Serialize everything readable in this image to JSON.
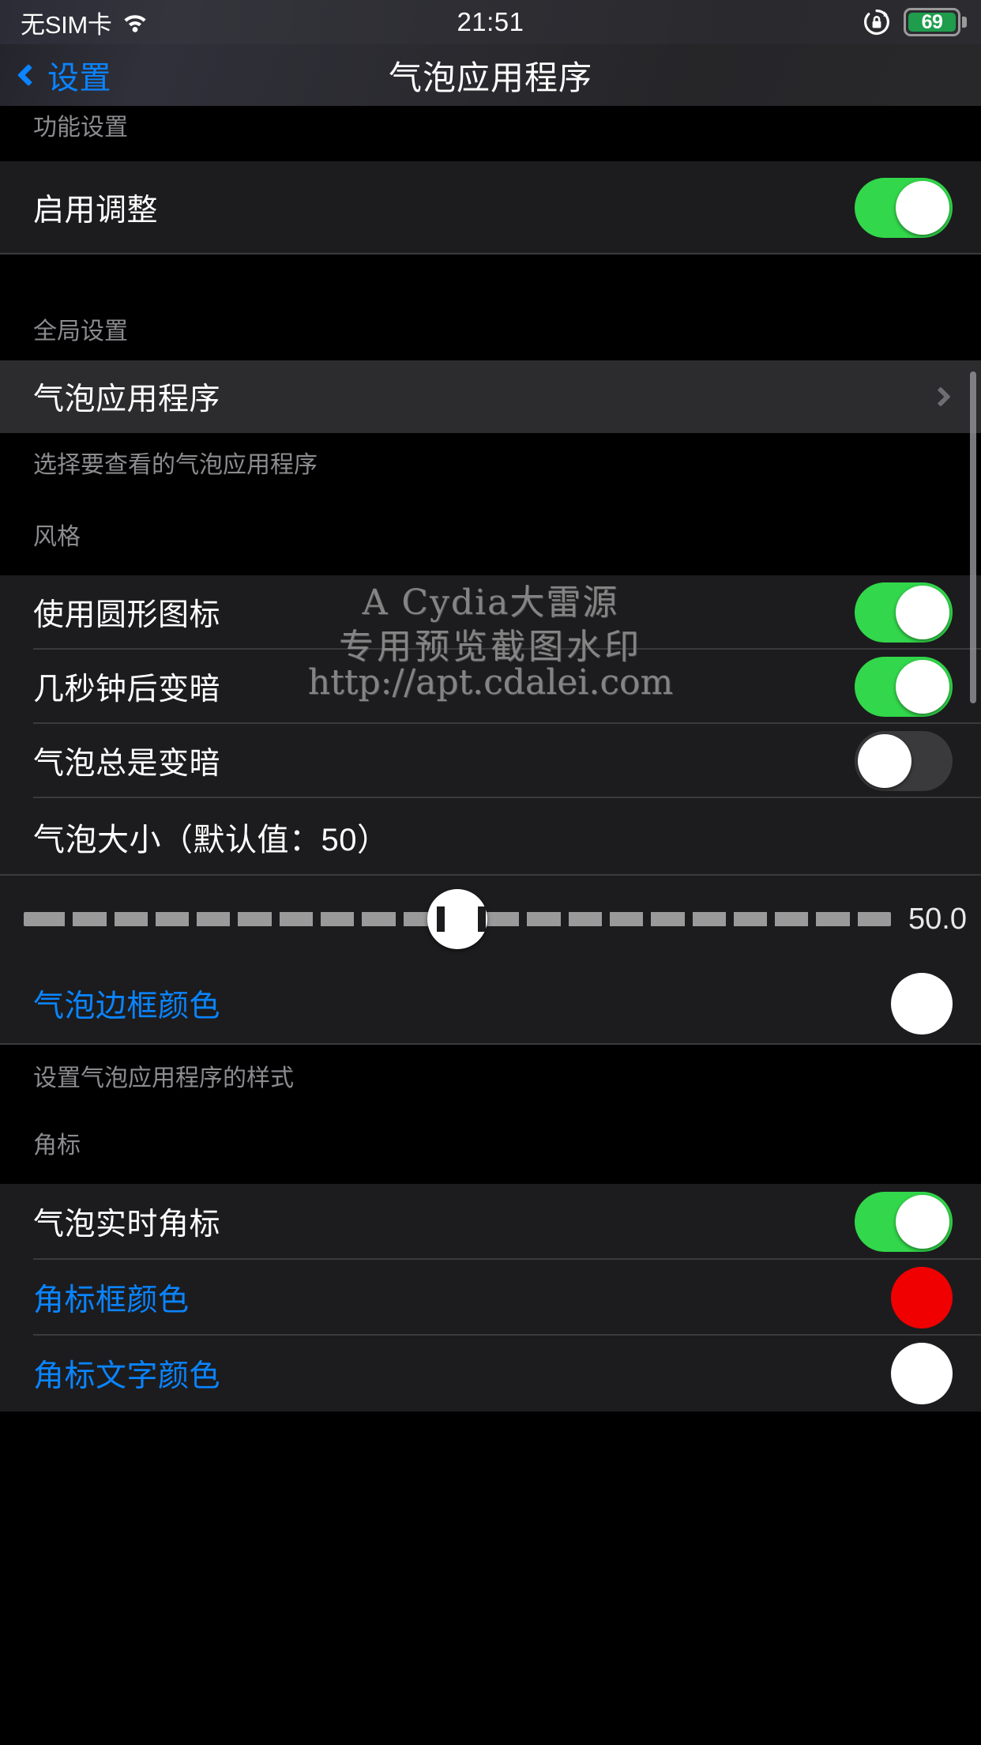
{
  "statusbar": {
    "carrier": "无SIM卡",
    "wifi_icon": "wifi-icon",
    "time": "21:51",
    "rotation_lock_icon": "rotation-lock-icon",
    "battery_percent": "69",
    "battery_color": "#1f9d4d"
  },
  "navbar": {
    "back_label": "设置",
    "back_chevron_icon": "chevron-left-icon",
    "title": "气泡应用程序",
    "accent_color": "#0a84ff"
  },
  "sections": [
    {
      "header": "功能设置",
      "rows": [
        {
          "label": "启用调整",
          "type": "toggle",
          "value": "on"
        }
      ],
      "footer": ""
    },
    {
      "header": "全局设置",
      "rows": [
        {
          "label": "气泡应用程序",
          "type": "disclosure",
          "icon": "chevron-right-icon",
          "highlighted": "true"
        }
      ],
      "footer": "选择要查看的气泡应用程序"
    },
    {
      "header": "风格",
      "rows": [
        {
          "label": "使用圆形图标",
          "type": "toggle",
          "value": "on"
        },
        {
          "label": "几秒钟后变暗",
          "type": "toggle",
          "value": "on"
        },
        {
          "label": "气泡总是变暗",
          "type": "toggle",
          "value": "off"
        },
        {
          "label": "气泡大小（默认值：50）",
          "type": "label"
        },
        {
          "label": "",
          "type": "slider",
          "value": "50.0",
          "min": "0",
          "max": "100",
          "display": "50.0"
        },
        {
          "label": "气泡边框颜色",
          "type": "color",
          "swatch": "#ffffff",
          "label_color": "blue"
        }
      ],
      "footer": "设置气泡应用程序的样式"
    },
    {
      "header": "角标",
      "rows": [
        {
          "label": "气泡实时角标",
          "type": "toggle",
          "value": "on"
        },
        {
          "label": "角标框颜色",
          "type": "color",
          "swatch": "#f00000",
          "label_color": "blue"
        },
        {
          "label": "角标文字颜色",
          "type": "color",
          "swatch": "#ffffff",
          "label_color": "blue"
        }
      ],
      "footer": ""
    }
  ],
  "watermark": {
    "line1": "A Cydia大雷源",
    "line2": "专用预览截图水印",
    "line3": "http://apt.cdalei.com"
  },
  "slider": {
    "value_label": "50.0",
    "tick_count": "21"
  }
}
